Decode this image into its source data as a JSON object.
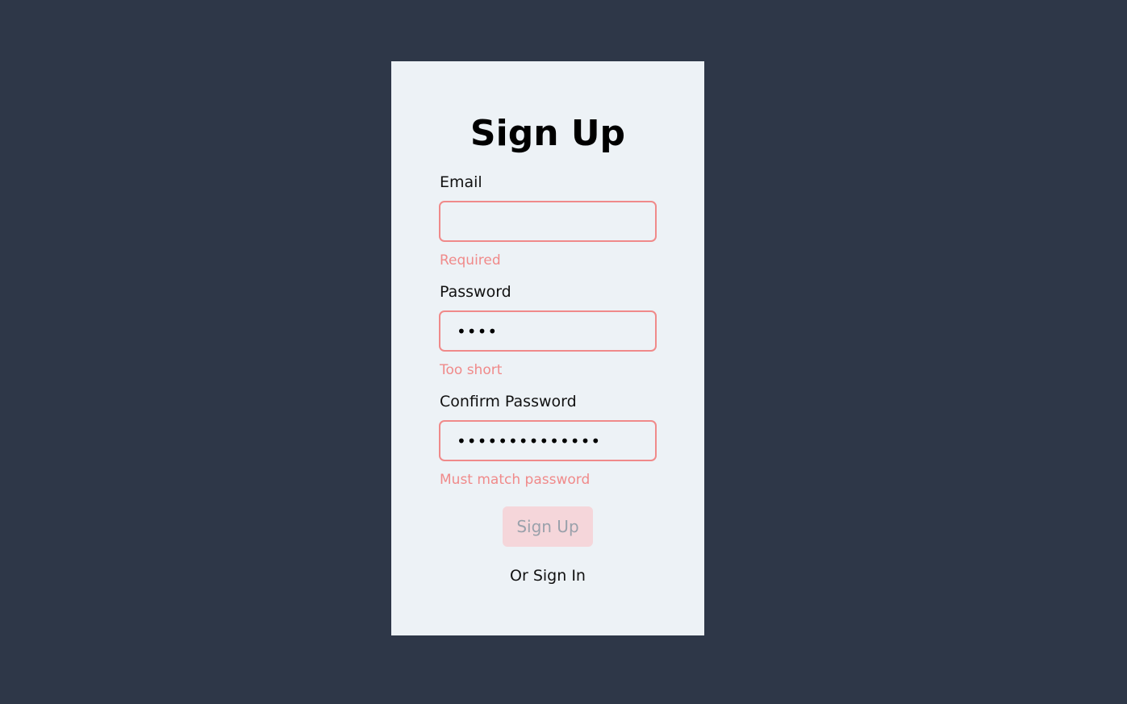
{
  "form": {
    "title": "Sign Up",
    "email": {
      "label": "Email",
      "value": "",
      "error": "Required"
    },
    "password": {
      "label": "Password",
      "value": "....",
      "error": "Too short"
    },
    "confirm_password": {
      "label": "Confirm Password",
      "value": "..............",
      "error": "Must match password"
    },
    "submit_label": "Sign Up",
    "alt_link_label": "Or Sign In"
  },
  "colors": {
    "background": "#2e3748",
    "card": "#edf2f6",
    "error": "#f08a8a",
    "button_disabled_bg": "#f5d6da",
    "button_disabled_text": "#9aa1ab"
  }
}
